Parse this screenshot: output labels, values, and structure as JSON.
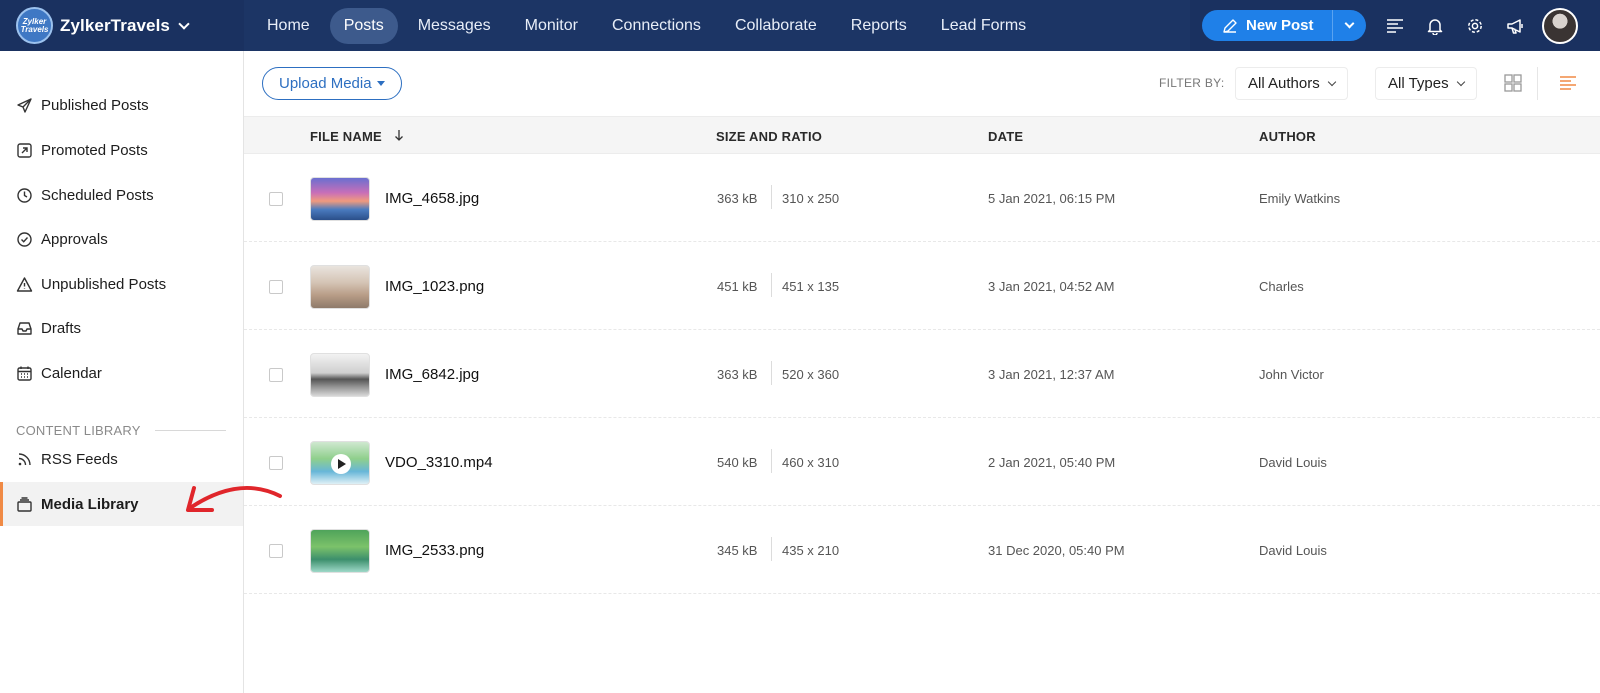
{
  "brand": {
    "name": "ZylkerTravels",
    "logo_line1": "Zylker",
    "logo_line2": "Travels"
  },
  "nav": {
    "items": [
      {
        "label": "Home"
      },
      {
        "label": "Posts"
      },
      {
        "label": "Messages"
      },
      {
        "label": "Monitor"
      },
      {
        "label": "Connections"
      },
      {
        "label": "Collaborate"
      },
      {
        "label": "Reports"
      },
      {
        "label": "Lead Forms"
      }
    ],
    "active": "Posts"
  },
  "header": {
    "new_post_label": "New Post"
  },
  "sidebar": {
    "items": [
      {
        "label": "Published Posts",
        "icon": "paper-plane-icon"
      },
      {
        "label": "Promoted Posts",
        "icon": "promote-arrow-icon"
      },
      {
        "label": "Scheduled Posts",
        "icon": "clock-icon"
      },
      {
        "label": "Approvals",
        "icon": "check-circle-icon"
      },
      {
        "label": "Unpublished Posts",
        "icon": "warning-triangle-icon"
      },
      {
        "label": "Drafts",
        "icon": "inbox-tray-icon"
      },
      {
        "label": "Calendar",
        "icon": "calendar-icon"
      }
    ],
    "section_title": "CONTENT LIBRARY",
    "library_items": [
      {
        "label": "RSS Feeds",
        "icon": "rss-icon"
      },
      {
        "label": "Media Library",
        "icon": "media-library-icon"
      }
    ],
    "active": "Media Library"
  },
  "toolbar": {
    "upload_label": "Upload Media",
    "filter_label": "FILTER BY:",
    "authors_value": "All Authors",
    "types_value": "All Types"
  },
  "table": {
    "headers": {
      "file_name": "FILE NAME",
      "size_ratio": "SIZE AND RATIO",
      "date": "DATE",
      "author": "AUTHOR"
    },
    "rows": [
      {
        "name": "IMG_4658.jpg",
        "size": "363 kB",
        "ratio": "310 x 250",
        "date": "5 Jan 2021, 06:15 PM",
        "author": "Emily Watkins"
      },
      {
        "name": "IMG_1023.png",
        "size": "451 kB",
        "ratio": "451 x 135",
        "date": "3 Jan 2021, 04:52 AM",
        "author": "Charles"
      },
      {
        "name": "IMG_6842.jpg",
        "size": "363 kB",
        "ratio": "520 x 360",
        "date": "3 Jan 2021, 12:37 AM",
        "author": "John Victor"
      },
      {
        "name": "VDO_3310.mp4",
        "size": "540 kB",
        "ratio": "460 x 310",
        "date": "2 Jan 2021, 05:40 PM",
        "author": "David Louis"
      },
      {
        "name": "IMG_2533.png",
        "size": "345 kB",
        "ratio": "435 x 210",
        "date": "31 Dec 2020, 05:40 PM",
        "author": "David Louis"
      }
    ]
  },
  "colors": {
    "topbar": "#1c3565",
    "accent_blue": "#1f80e8",
    "active_marker": "#f08a45",
    "annotation_red": "#e0262b"
  }
}
